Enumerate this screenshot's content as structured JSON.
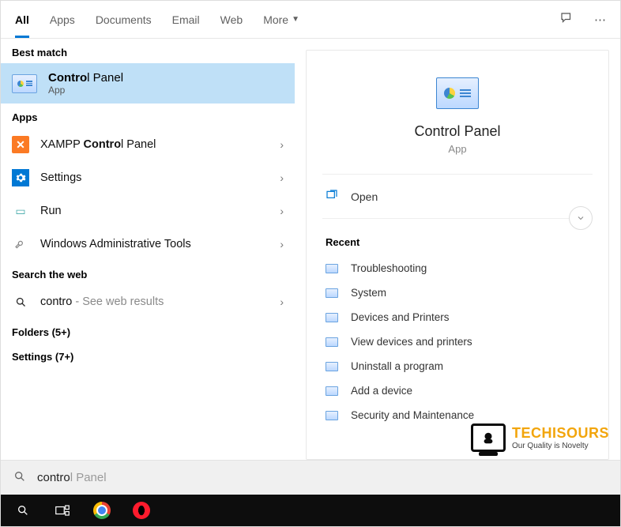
{
  "tabs": {
    "all": "All",
    "apps": "Apps",
    "documents": "Documents",
    "email": "Email",
    "web": "Web",
    "more": "More"
  },
  "sections": {
    "best_match": "Best match",
    "apps": "Apps",
    "search_web": "Search the web"
  },
  "best_match": {
    "title_bold": "Contro",
    "title_rest": "l Panel",
    "sub": "App"
  },
  "app_rows": {
    "xampp_pre": "XAMPP ",
    "xampp_bold": "Contro",
    "xampp_post": "l Panel",
    "settings": "Settings",
    "run": "Run",
    "admin": "Windows Administrative Tools"
  },
  "web_row": {
    "q": "contro",
    "suffix": " - See web results"
  },
  "folders_label": "Folders (5+)",
  "settings_label": "Settings (7+)",
  "preview": {
    "title": "Control Panel",
    "sub": "App"
  },
  "action_open": "Open",
  "recent_head": "Recent",
  "recent": {
    "r0": "Troubleshooting",
    "r1": "System",
    "r2": "Devices and Printers",
    "r3": "View devices and printers",
    "r4": "Uninstall a program",
    "r5": "Add a device",
    "r6": "Security and Maintenance"
  },
  "watermark": {
    "brand": "TECHISOURS",
    "tag": "Our Quality is Novelty"
  },
  "search": {
    "typed": "contro",
    "hint": "l Panel"
  }
}
